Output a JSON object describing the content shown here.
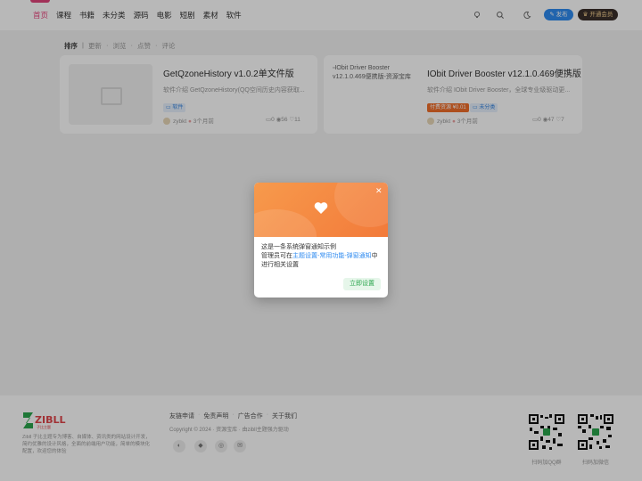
{
  "header": {
    "nav": [
      {
        "label": "首页",
        "active": true
      },
      {
        "label": "课程"
      },
      {
        "label": "书籍"
      },
      {
        "label": "未分类"
      },
      {
        "label": "源码"
      },
      {
        "label": "电影"
      },
      {
        "label": "短剧"
      },
      {
        "label": "素材"
      },
      {
        "label": "软件"
      }
    ],
    "icons": [
      "lightbulb-icon",
      "search-icon",
      "moon-icon"
    ],
    "publish_label": "发布",
    "vip_label": "开通会员"
  },
  "sortbar": {
    "label": "排序",
    "options": [
      "更新",
      "浏览",
      "点赞",
      "评论"
    ]
  },
  "posts": [
    {
      "title": "GetQzoneHistory v1.0.2单文件版",
      "desc": "软件介绍 GetQzoneHistory(QQ空间历史内容获取...",
      "tags": [
        {
          "label": "软件",
          "style": "blue"
        }
      ],
      "author": "zybkt",
      "time": "3个月前",
      "comments": "0",
      "views": "56",
      "likes": "11"
    },
    {
      "title": "IObit Driver Booster v12.1.0.469便携版",
      "thumb_alt": "IObit Driver Booster v12.1.0.469便携版-资源宝库",
      "desc": "软件介绍 IObit Driver Booster，全球专业级驱动更...",
      "tags": [
        {
          "label": "付费资源 ¥0.01",
          "style": "orange"
        },
        {
          "label": "未分类",
          "style": "blue"
        }
      ],
      "author": "zybkt",
      "time": "3个月前",
      "comments": "0",
      "views": "47",
      "likes": "7"
    }
  ],
  "modal": {
    "line1": "这是一条系统弹窗通知示例",
    "line2_prefix": "管理员可在",
    "line2_link": "主题设置-常用功能-弹窗通知",
    "line2_suffix": "中",
    "line3": "进行相关设置",
    "button": "立即设置"
  },
  "footer": {
    "logo_text": "ZIBLL",
    "logo_sub": "子比主题",
    "desc": "Zibll 子比主题专为博客、自媒体、资讯类的网站设计开发，简约优雅的设计风格，全面的前端用户功能，简单的模块化配置，欢迎您的体验",
    "links": [
      "友链申请",
      "免责声明",
      "广告合作",
      "关于我们"
    ],
    "copyright": "Copyright © 2024 · 资源宝库 · 由zibll主题强力驱动",
    "social_icons": [
      "wechat-icon",
      "qq-icon",
      "weibo-icon",
      "email-icon"
    ],
    "qr": [
      {
        "label": "扫码加QQ群"
      },
      {
        "label": "扫码加微信"
      }
    ]
  },
  "colors": {
    "accent": "#e8457d",
    "publish": "#2f8bf0",
    "vip_bg": "#3a2f2a",
    "modal_head": "#f27a3a",
    "confirm_text": "#2aa54d"
  }
}
